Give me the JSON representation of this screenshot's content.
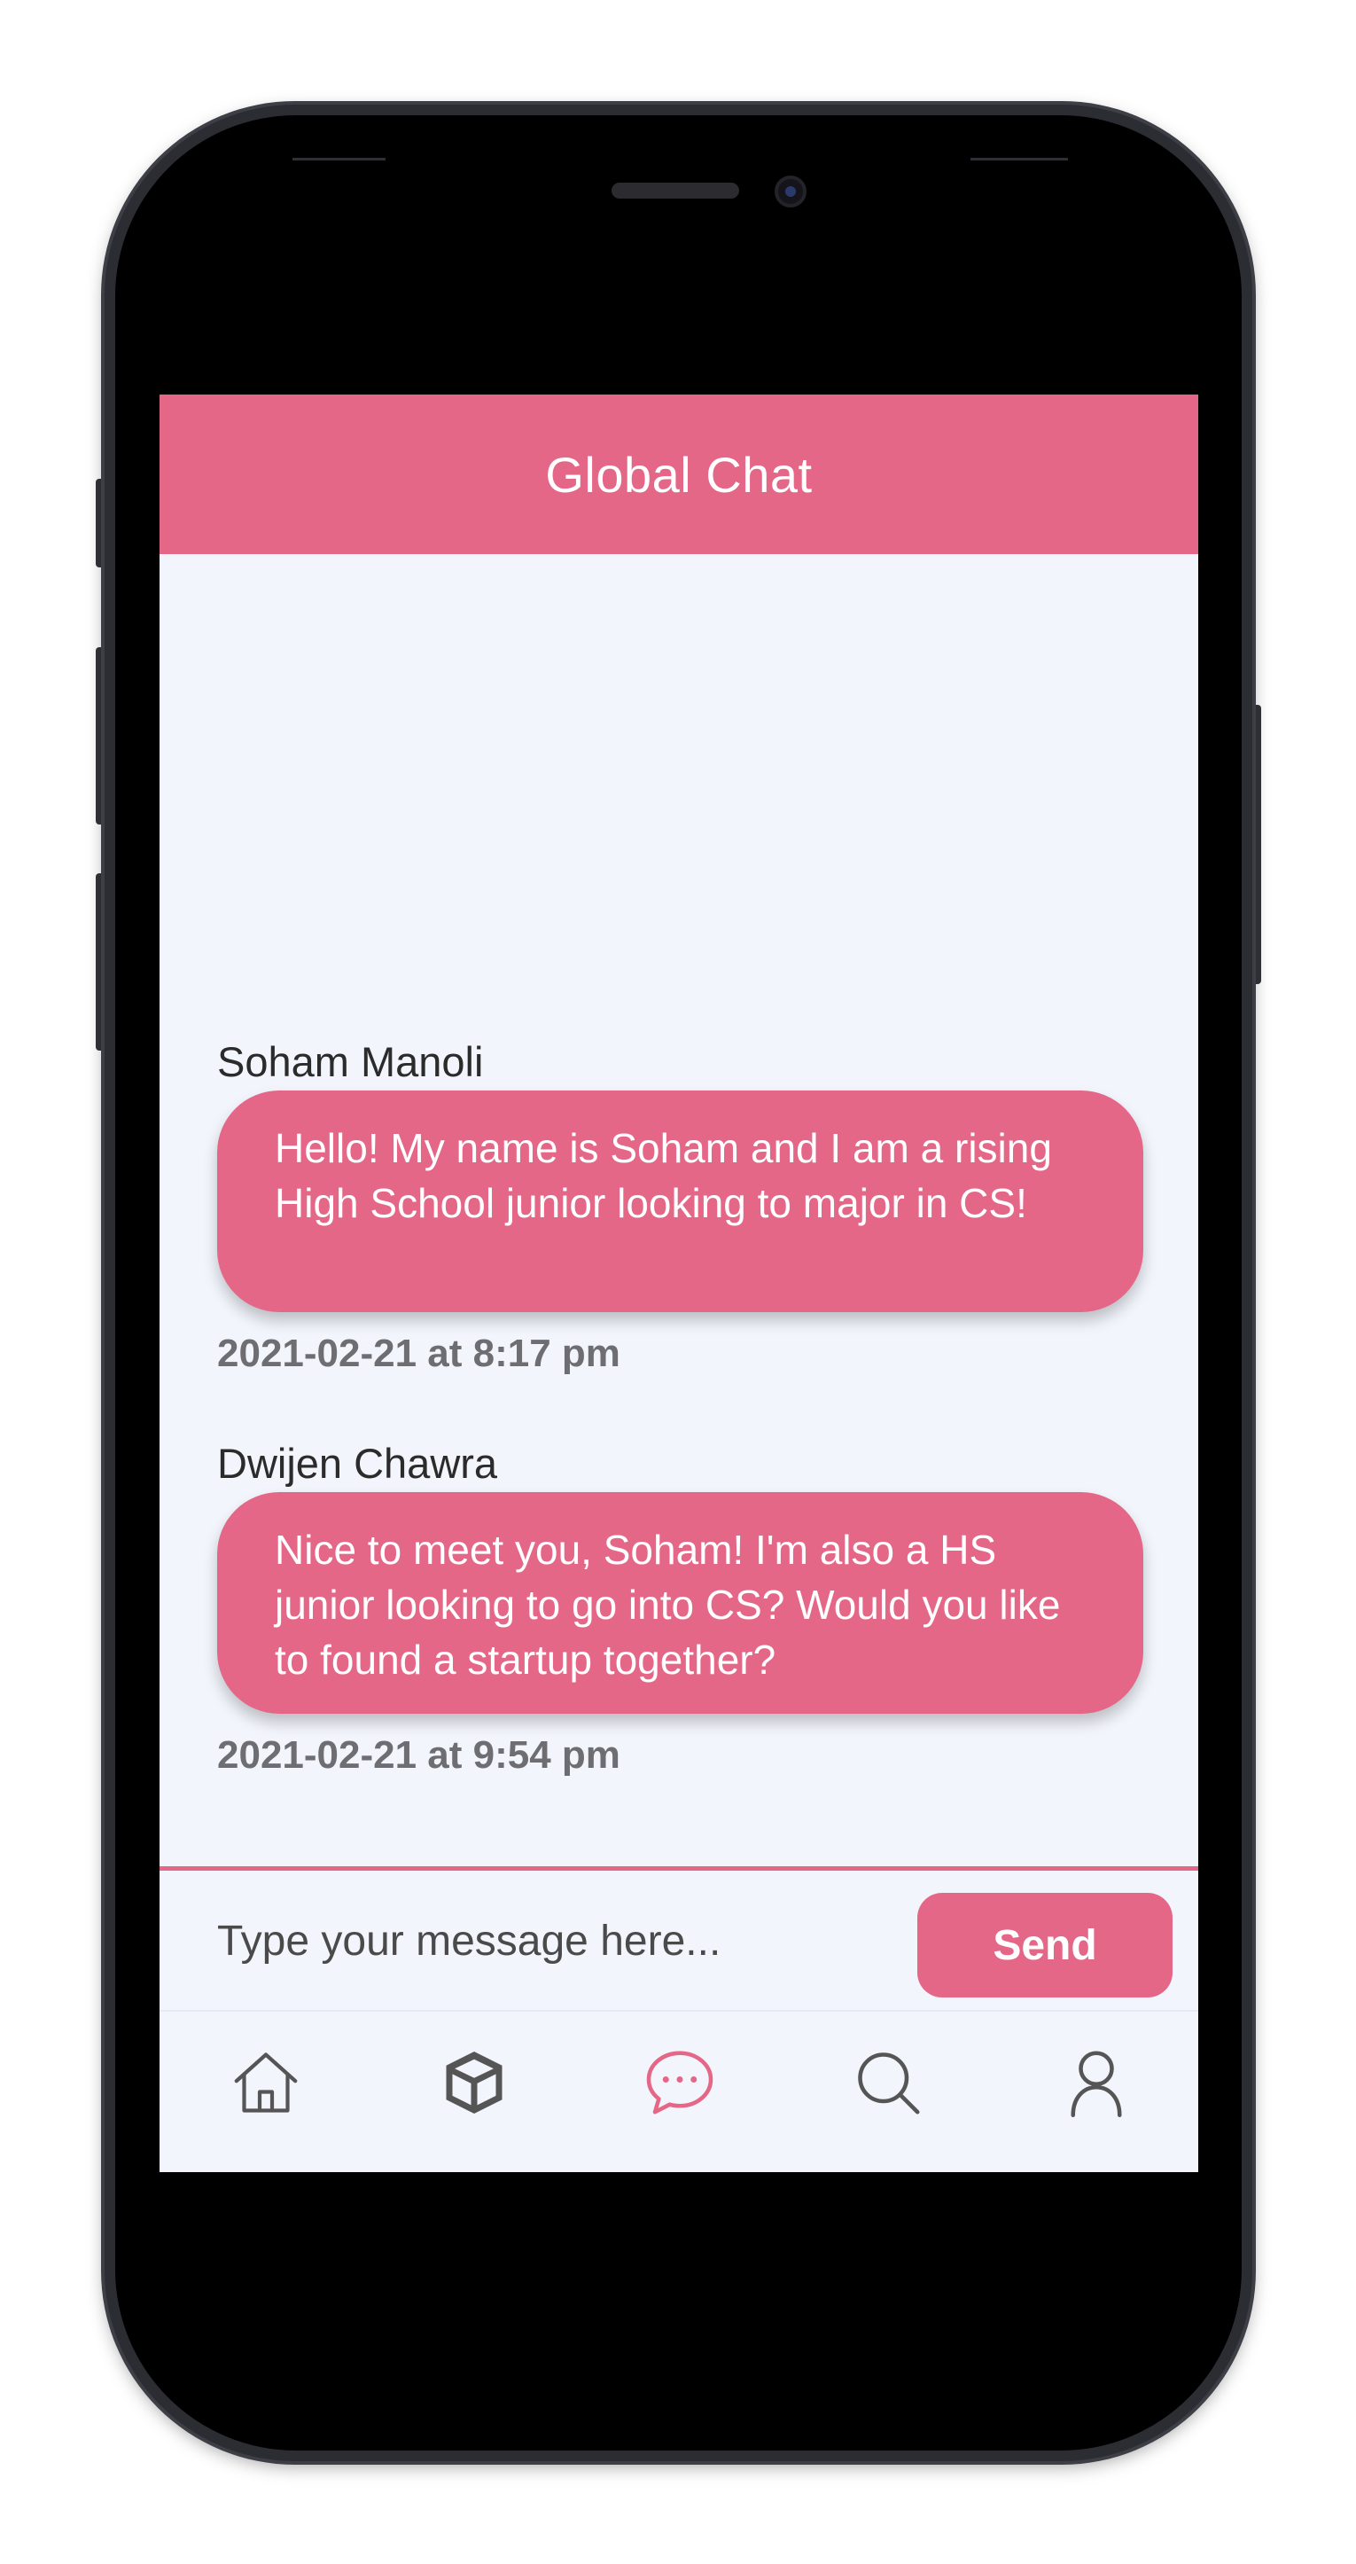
{
  "header": {
    "title": "Global Chat"
  },
  "messages": [
    {
      "sender": "Soham Manoli",
      "text": "Hello! My name is Soham and I am a rising High School junior looking to major in CS!",
      "timestamp": "2021-02-21 at 8:17 pm"
    },
    {
      "sender": "Dwijen Chawra",
      "text": "Nice to meet you, Soham! I'm also a HS junior looking to go into CS? Would you like to found a startup together?",
      "timestamp": "2021-02-21 at 9:54 pm"
    }
  ],
  "composer": {
    "placeholder": "Type your message here...",
    "send_label": "Send"
  },
  "nav": {
    "items": [
      {
        "icon": "home-icon",
        "active": false
      },
      {
        "icon": "cube-icon",
        "active": false
      },
      {
        "icon": "chat-bubble-icon",
        "active": true
      },
      {
        "icon": "search-icon",
        "active": false
      },
      {
        "icon": "profile-icon",
        "active": false
      }
    ]
  },
  "colors": {
    "accent": "#e46787",
    "background": "#f2f5fc",
    "timestamp": "#6e6e72",
    "icon_inactive": "#555555"
  }
}
